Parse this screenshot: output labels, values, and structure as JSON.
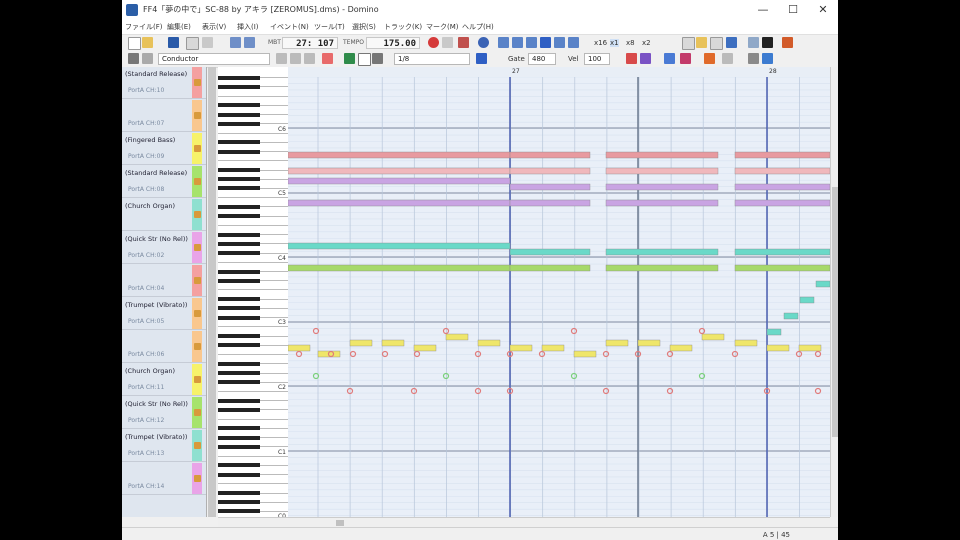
{
  "window": {
    "title": "FF4「夢の中で」SC-88 by アキラ [ZEROMUS].dms) - Domino",
    "minimize": "—",
    "maximize": "☐",
    "close": "✕"
  },
  "menu": [
    "ファイル(F)",
    "編集(E)",
    "表示(V)",
    "挿入(I)",
    "イベント(N)",
    "ツール(T)",
    "選択(S)",
    "トラック(K)",
    "マーク(M)",
    "ヘルプ(H)"
  ],
  "toolbar": {
    "position_label": "MBT",
    "position": "27: 107",
    "tempo_label": "TEMPO",
    "tempo": "175.00",
    "zoom_a": "x16",
    "zoom_b": "x1",
    "zoom_c": "x8",
    "zoom_d": "x2"
  },
  "toolbar2": {
    "track_select": "Conductor",
    "note_length": "1/8",
    "gate_label": "Gate",
    "gate_value": "480",
    "vel_label": "Vel",
    "vel_value": "100"
  },
  "tracks": [
    {
      "name": "(Standard Release)",
      "port": "PortA   CH:10",
      "color": "#f4a0a0"
    },
    {
      "name": "",
      "port": "PortA   CH:07",
      "color": "#f9c78e"
    },
    {
      "name": "(Fingered Bass)",
      "port": "PortA   CH:09",
      "color": "#f7f26a"
    },
    {
      "name": "(Standard Release)",
      "port": "PortA   CH:08",
      "color": "#a6e36c"
    },
    {
      "name": "(Church Organ)",
      "port": "",
      "color": "#8fe0d0"
    },
    {
      "name": "(Quick Str (No Rel))",
      "port": "PortA   CH:02",
      "color": "#e9a4e8"
    },
    {
      "name": "",
      "port": "PortA   CH:04",
      "color": "#f4a0a0"
    },
    {
      "name": "(Trumpet (Vibrato))",
      "port": "PortA   CH:05",
      "color": "#f9c78e"
    },
    {
      "name": "",
      "port": "PortA   CH:06",
      "color": "#f9c78e"
    },
    {
      "name": "(Church Organ)",
      "port": "PortA   CH:11",
      "color": "#f7f26a"
    },
    {
      "name": "(Quick Str (No Rel))",
      "port": "PortA   CH:12",
      "color": "#a6e36c"
    },
    {
      "name": "(Trumpet (Vibrato))",
      "port": "PortA   CH:13",
      "color": "#8fe0d0"
    },
    {
      "name": "",
      "port": "PortA   CH:14",
      "color": "#e9a4e8"
    }
  ],
  "octave_labels": [
    "C6",
    "C5",
    "C4",
    "C3",
    "C2",
    "C1",
    "C0"
  ],
  "ruler": {
    "measure_a": "27",
    "measure_b": "28"
  },
  "status": {
    "text": "A  5 | 45"
  },
  "chart_data": {
    "type": "piano-roll",
    "measures_visible": [
      "27",
      "28"
    ],
    "note_colors": {
      "strings_red": "#e89aa0",
      "strings_purple": "#c9a4e3",
      "organ_teal": "#6ad9c8",
      "organ_green": "#a6d96a",
      "trumpet_yellow": "#efe66a",
      "percussion_red": "#e07a7a",
      "percussion_green": "#7ad07a"
    }
  }
}
